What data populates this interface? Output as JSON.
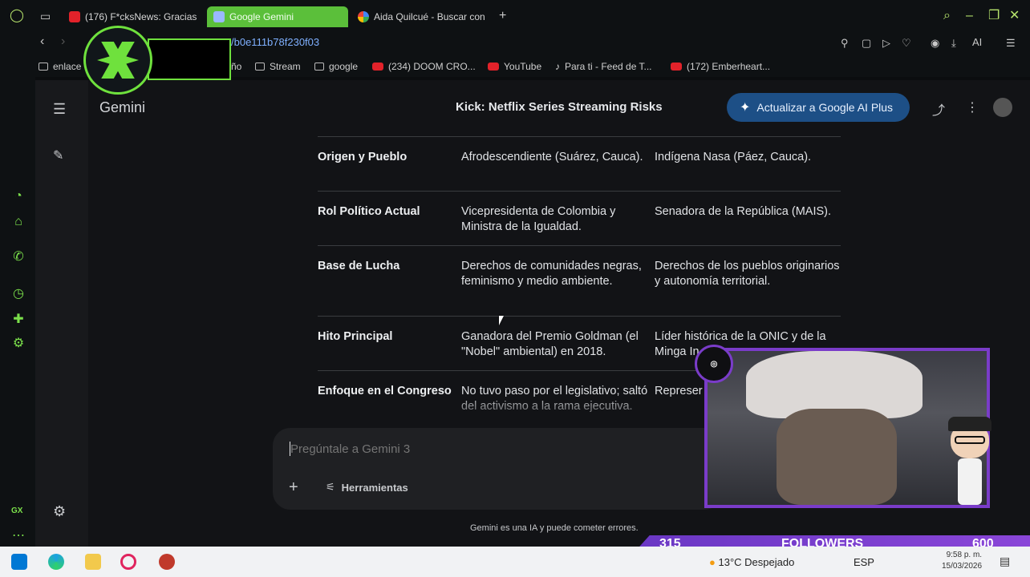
{
  "browser": {
    "tabs": [
      {
        "label": "(176) F*cksNews: Gracias",
        "icon": "youtube-icon",
        "active": false
      },
      {
        "label": "Google Gemini",
        "icon": "gemini-icon",
        "active": true
      },
      {
        "label": "Aida Quilcué - Buscar con",
        "icon": "google-icon",
        "active": false
      }
    ],
    "url": "/b0e111b78f230f03",
    "bookmarks": [
      {
        "label": "enlace",
        "icon": "folder-icon"
      },
      {
        "label": "ño",
        "icon": "folder-icon"
      },
      {
        "label": "Stream",
        "icon": "folder-icon"
      },
      {
        "label": "google",
        "icon": "folder-icon"
      },
      {
        "label": "(234) DOOM CRO...",
        "icon": "youtube-icon"
      },
      {
        "label": "YouTube",
        "icon": "youtube-icon"
      },
      {
        "label": "Para ti - Feed de T...",
        "icon": "tiktok-icon"
      },
      {
        "label": "(172) Emberheart...",
        "icon": "youtube-icon"
      }
    ],
    "toolbar_ai_label": "AI",
    "gx_label": "GX",
    "accent_color": "#6fe13d"
  },
  "gemini": {
    "app_name": "Gemini",
    "conversation_title": "Kick: Netflix Series Streaming Risks",
    "upgrade_label": "Actualizar a Google AI Plus",
    "table_rows": [
      {
        "label": "Origen y Pueblo",
        "col1": "Afrodescendiente (Suárez, Cauca).",
        "col2": "Indígena Nasa (Páez, Cauca)."
      },
      {
        "label": "Rol Político Actual",
        "col1": "Vicepresidenta de Colombia y Ministra de la Igualdad.",
        "col2": "Senadora de la República (MAIS)."
      },
      {
        "label": "Base de Lucha",
        "col1": "Derechos de comunidades negras, feminismo y medio ambiente.",
        "col2": "Derechos de los pueblos originarios y autonomía territorial."
      },
      {
        "label": "Hito Principal",
        "col1": "Ganadora del Premio Goldman (el \"Nobel\" ambiental) en 2018.",
        "col2": "Líder histórica de la ONIC y de la Minga In"
      },
      {
        "label": "Enfoque en el Congreso",
        "col1": "No tuvo paso por el legislativo; saltó del activismo a la rama ejecutiva.",
        "col2": "Represer indígenas"
      }
    ],
    "prompt_placeholder": "Pregúntale a Gemini 3",
    "tools_label": "Herramientas",
    "disclaimer": "Gemini es una IA y puede cometer errores."
  },
  "stream_overlay": {
    "followers_current": "315",
    "followers_label": "FOLLOWERS",
    "followers_goal": "600",
    "progress_fraction": 0.525
  },
  "taskbar": {
    "weather": "13°C  Despejado",
    "language": "ESP",
    "time": "9:58 p. m.",
    "date": "15/03/2026"
  }
}
